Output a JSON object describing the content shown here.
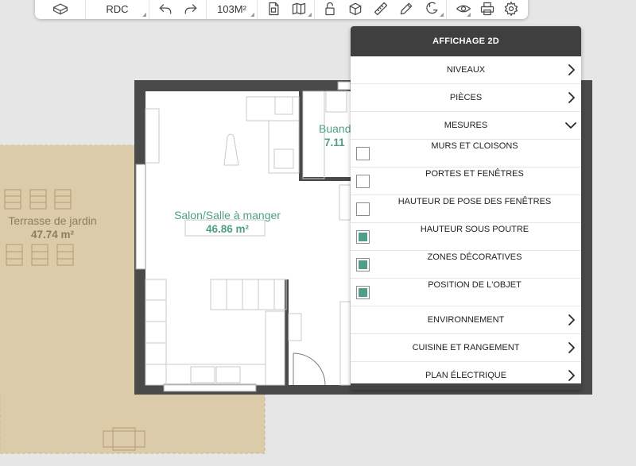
{
  "toolbar": {
    "level": "RDC",
    "surface": "103M²",
    "icons": [
      "box-icon",
      "undo-icon",
      "redo-icon",
      "document-icon",
      "map-icon",
      "lock-icon",
      "cube-icon",
      "ruler-icon",
      "pencil-icon",
      "magnet-icon",
      "eye-icon",
      "print-icon",
      "gear-icon"
    ]
  },
  "plan": {
    "rooms": [
      {
        "name": "Salon/Salle à manger",
        "area": "46.86 m²"
      },
      {
        "name": "Terrasse de jardin",
        "area": "47.74 m²"
      },
      {
        "name": "Buand",
        "area": "7.11"
      }
    ],
    "colors": {
      "room_label": "#4f9e8a",
      "terrace_fill": "#dccba8",
      "terrace_label": "#8a7d63",
      "wall": "#4a4a4a"
    }
  },
  "panel": {
    "title": "AFFICHAGE 2D",
    "items": [
      {
        "label": "NIVEAUX"
      },
      {
        "label": "PIÈCES"
      },
      {
        "label": "MESURES"
      }
    ],
    "options": [
      {
        "label": "MURS ET CLOISONS",
        "checked": false
      },
      {
        "label": "PORTES ET FENÊTRES",
        "checked": false
      },
      {
        "label": "HAUTEUR DE POSE DES FENÊTRES",
        "checked": false
      },
      {
        "label": "HAUTEUR SOUS POUTRE",
        "checked": true
      },
      {
        "label": "ZONES DÉCORATIVES",
        "checked": true
      },
      {
        "label": "POSITION DE L'OBJET",
        "checked": true
      }
    ],
    "more": [
      {
        "label": "ENVIRONNEMENT"
      },
      {
        "label": "CUISINE ET RANGEMENT"
      },
      {
        "label": "PLAN ÉLECTRIQUE"
      }
    ],
    "accent": "#4f9e8a",
    "header_color": "#3f3f3f"
  }
}
